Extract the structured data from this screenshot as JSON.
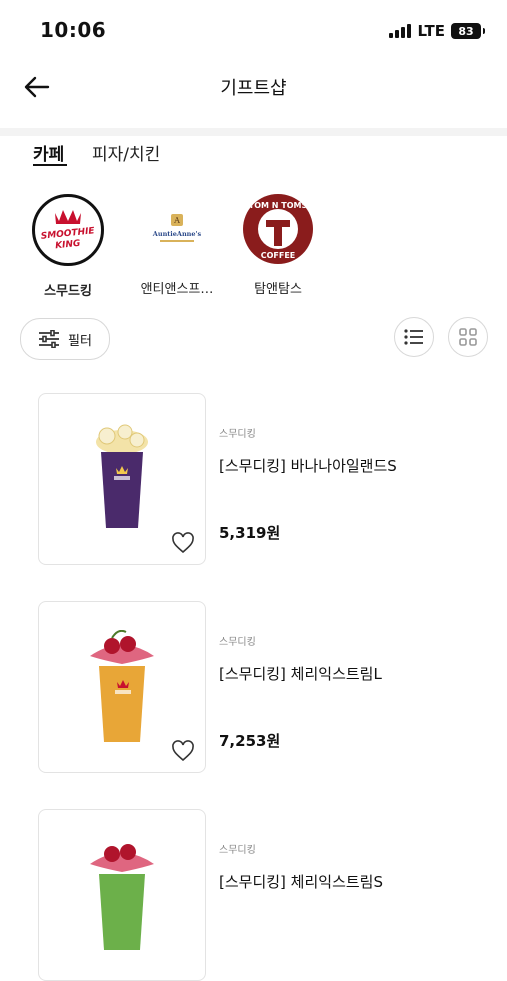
{
  "status": {
    "time": "10:06",
    "network": "LTE",
    "battery": "83"
  },
  "header": {
    "title": "기프트샵"
  },
  "tabs": [
    {
      "label": "카페"
    },
    {
      "label": "피자/치킨"
    }
  ],
  "brands": [
    {
      "label": "스무드킹",
      "logo_text_1": "SMOOTHIE",
      "logo_text_2": "KING"
    },
    {
      "label": "앤티앤스프…",
      "logo_text_1": "AuntieAnne's"
    },
    {
      "label": "탐앤탐스",
      "logo_text_1": "TOM N TOMS",
      "logo_text_2": "COFFEE"
    }
  ],
  "filter": {
    "label": "필터"
  },
  "products": [
    {
      "brand": "스무디킹",
      "name": "[스무디킹] 바나나아일랜드S",
      "price": "5,319원",
      "cup_color": "#4a2a6b",
      "topping": "banana"
    },
    {
      "brand": "스무디킹",
      "name": "[스무디킹] 체리익스트림L",
      "price": "7,253원",
      "cup_color": "#e8a637",
      "topping": "cherry"
    },
    {
      "brand": "스무디킹",
      "name": "[스무디킹] 체리익스트림S",
      "price": "",
      "cup_color": "#6cb04a",
      "topping": "cherry"
    }
  ],
  "colors": {
    "brand_red": "#c8102e",
    "tomntoms_red": "#8a1c1c"
  },
  "icons": [
    "back-arrow-icon",
    "filter-sliders-icon",
    "list-view-icon",
    "grid-view-icon",
    "heart-icon"
  ]
}
